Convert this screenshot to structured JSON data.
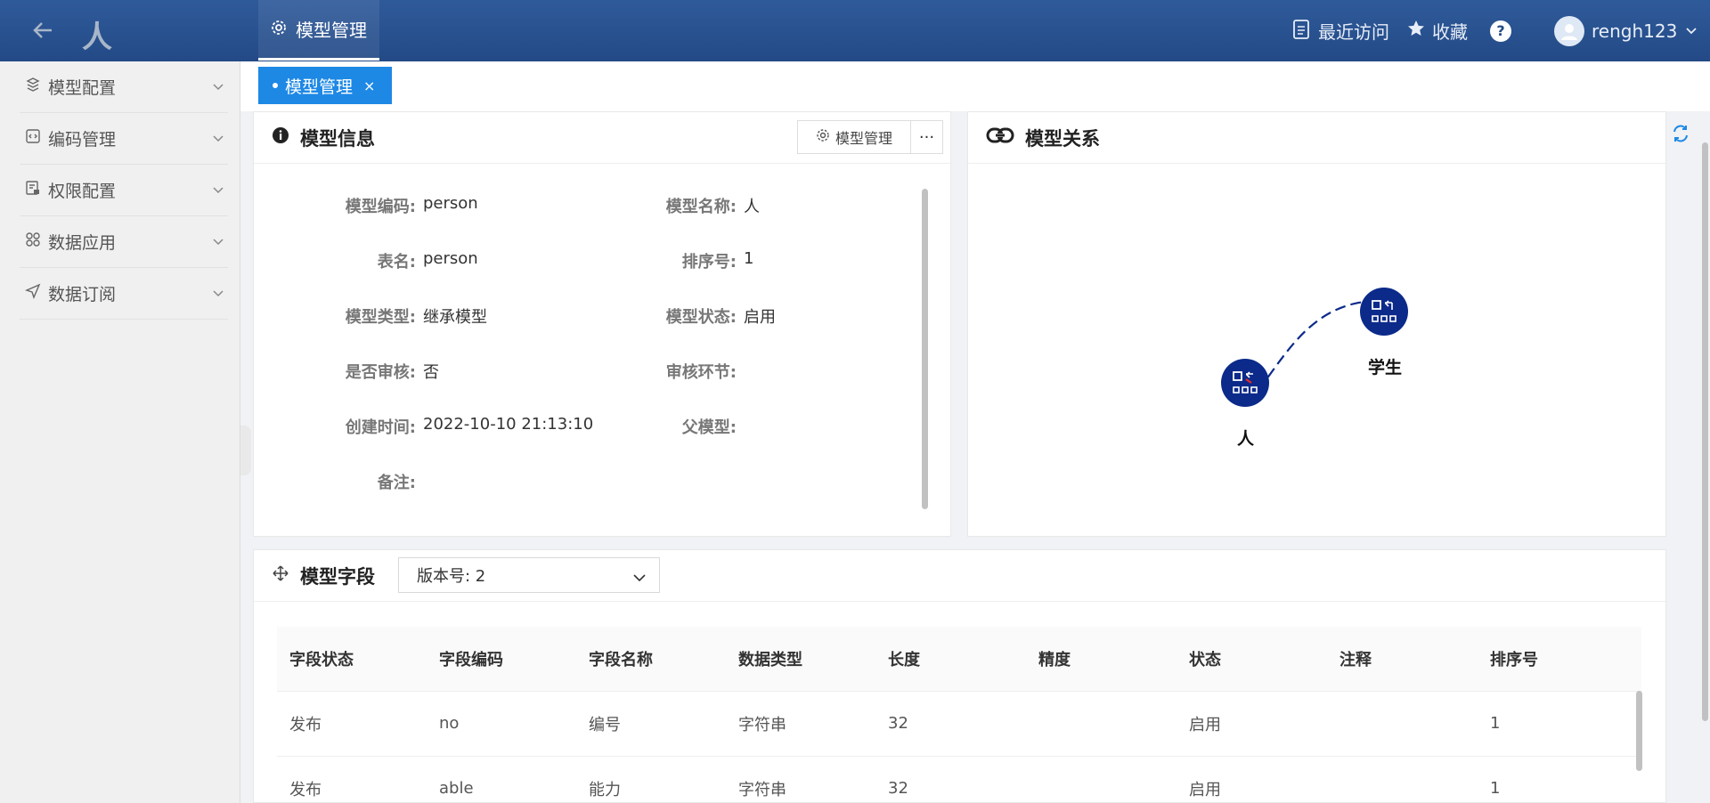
{
  "header": {
    "app_logo_text": "人",
    "top_nav_label": "模型管理",
    "recent_label": "最近访问",
    "favorite_label": "收藏",
    "help_label": "?",
    "username": "rengh123"
  },
  "sidebar": {
    "items": [
      {
        "label": "模型配置",
        "icon": "cube-stack-icon"
      },
      {
        "label": "编码管理",
        "icon": "code-icon"
      },
      {
        "label": "权限配置",
        "icon": "permission-doc-icon"
      },
      {
        "label": "数据应用",
        "icon": "apps-grid-icon"
      },
      {
        "label": "数据订阅",
        "icon": "send-icon"
      }
    ]
  },
  "tabs": [
    {
      "label": "模型管理",
      "close": "×"
    }
  ],
  "model_info": {
    "title": "模型信息",
    "manage_button": "模型管理",
    "more_button": "···",
    "fields": {
      "code_label": "模型编码:",
      "code_value": "person",
      "name_label": "模型名称:",
      "name_value": "人",
      "table_label": "表名:",
      "table_value": "person",
      "order_label": "排序号:",
      "order_value": "1",
      "type_label": "模型类型:",
      "type_value": "继承模型",
      "status_label": "模型状态:",
      "status_value": "启用",
      "audit_label": "是否审核:",
      "audit_value": "否",
      "audit_step_label": "审核环节:",
      "audit_step_value": "",
      "created_label": "创建时间:",
      "created_value": "2022-10-10 21:13:10",
      "parent_label": "父模型:",
      "parent_value": "",
      "remark_label": "备注:",
      "remark_value": ""
    }
  },
  "model_relation": {
    "title": "模型关系",
    "nodes": [
      {
        "label": "人"
      },
      {
        "label": "学生"
      }
    ],
    "accent": "#0b2a8a"
  },
  "model_fields": {
    "title": "模型字段",
    "version_select": "版本号: 2",
    "columns": [
      "字段状态",
      "字段编码",
      "字段名称",
      "数据类型",
      "长度",
      "精度",
      "状态",
      "注释",
      "排序号"
    ],
    "rows": [
      [
        "发布",
        "no",
        "编号",
        "字符串",
        "32",
        "",
        "启用",
        "",
        "1"
      ],
      [
        "发布",
        "able",
        "能力",
        "字符串",
        "32",
        "",
        "启用",
        "",
        "1"
      ]
    ]
  },
  "colors": {
    "header": "#234a86",
    "tab_active": "#1e88e5",
    "node": "#0b2a8a"
  }
}
